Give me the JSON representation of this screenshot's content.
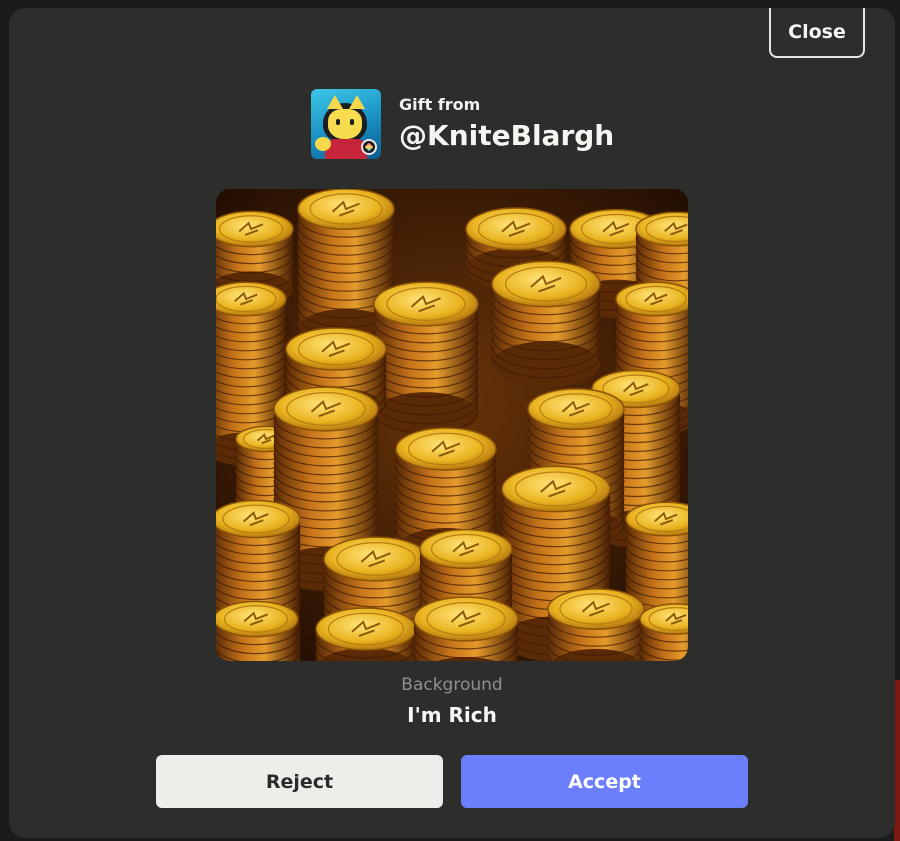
{
  "modal": {
    "close_label": "Close"
  },
  "sender": {
    "gift_from_label": "Gift from",
    "handle": "@KniteBlargh",
    "avatar_icon": "cat-avatar-icon"
  },
  "item": {
    "image_icon": "gold-coins-background-image",
    "type": "Background",
    "name": "I'm Rich"
  },
  "actions": {
    "reject_label": "Reject",
    "accept_label": "Accept"
  },
  "colors": {
    "modal_bg": "#2d2d2b",
    "accept_bg": "#6b7ffd",
    "reject_bg": "#ededea",
    "coin_gold": "#e8b21c"
  }
}
